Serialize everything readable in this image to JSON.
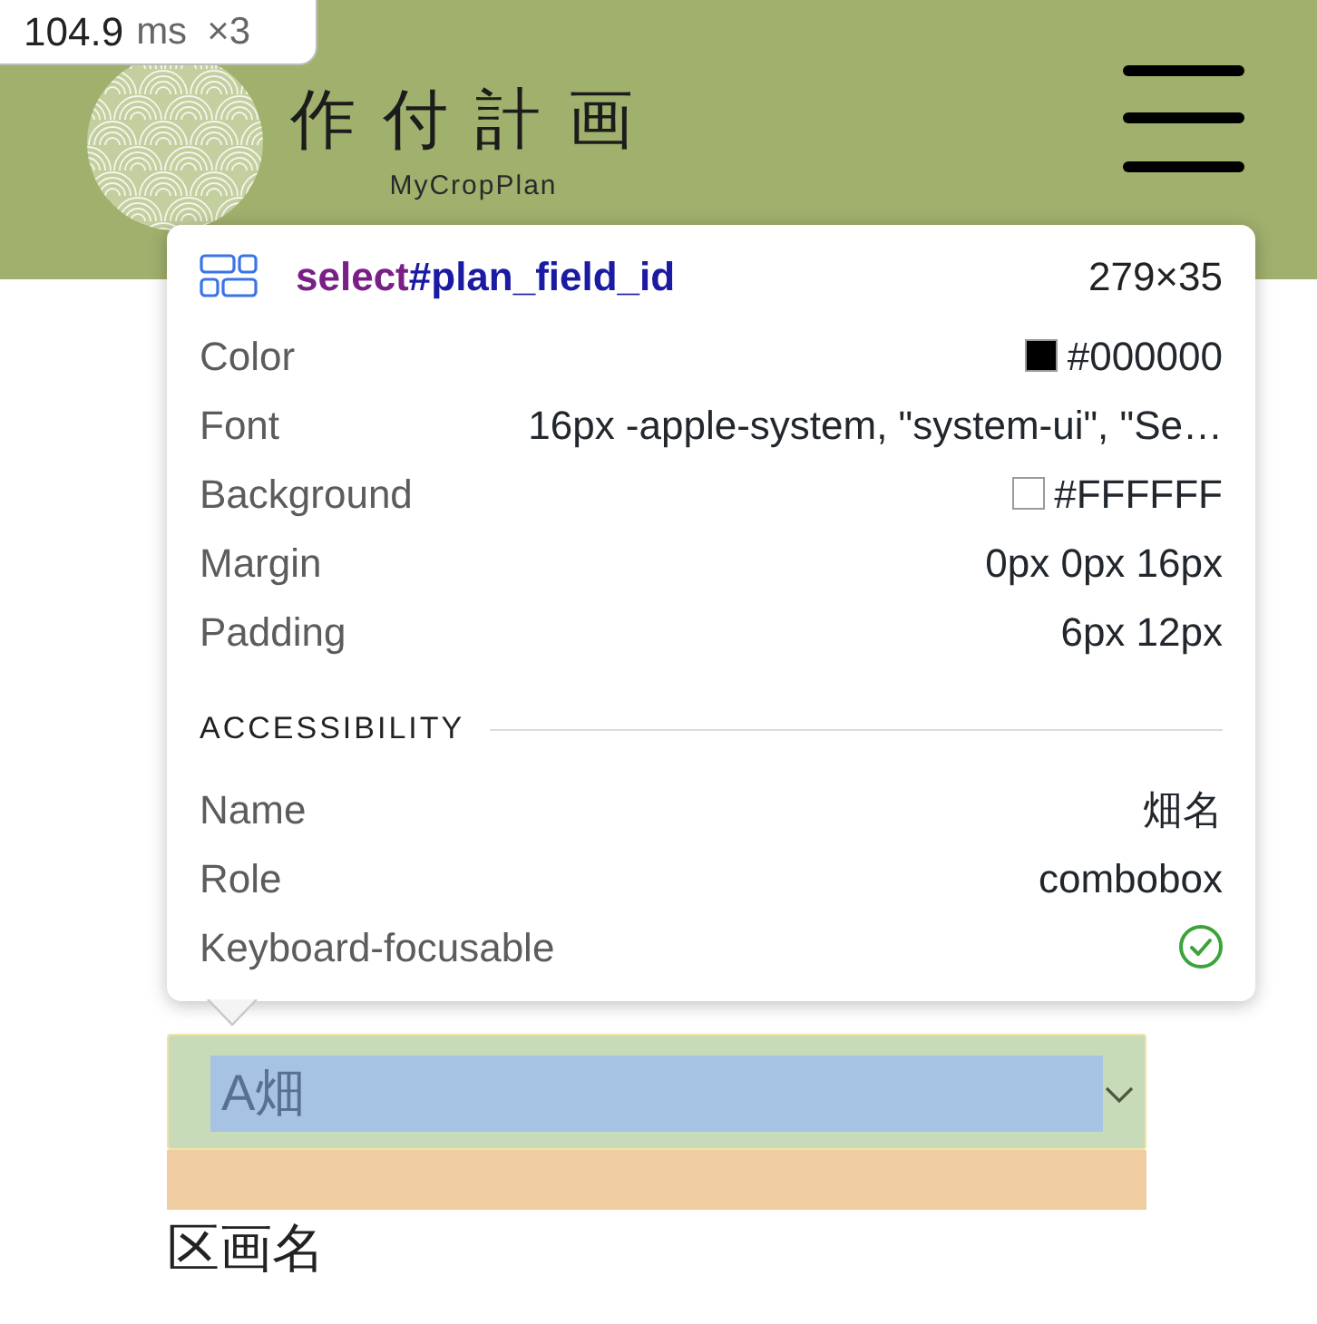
{
  "frame_badge": {
    "time": "104.9",
    "unit": "ms",
    "count": "×3"
  },
  "header": {
    "title": "作付計画",
    "subtitle": "MyCropPlan"
  },
  "inspector": {
    "selector_tag": "select",
    "selector_id": "#plan_field_id",
    "size": "279×35",
    "properties": [
      {
        "label": "Color",
        "value": "#000000",
        "color": "#000000"
      },
      {
        "label": "Font",
        "value": "16px -apple-system, \"system-ui\", \"Se…"
      },
      {
        "label": "Background",
        "value": "#FFFFFF",
        "color": "#ffffff"
      },
      {
        "label": "Margin",
        "value": "0px 0px 16px"
      },
      {
        "label": "Padding",
        "value": "6px 12px"
      }
    ],
    "accessibility_heading": "ACCESSIBILITY",
    "accessibility": [
      {
        "kind": "text",
        "label": "Name",
        "value": "畑名"
      },
      {
        "kind": "text",
        "label": "Role",
        "value": "combobox"
      },
      {
        "kind": "check",
        "label": "Keyboard-focusable",
        "checked": true
      }
    ]
  },
  "field_select": {
    "value": "A畑"
  },
  "next_label": "区画名"
}
